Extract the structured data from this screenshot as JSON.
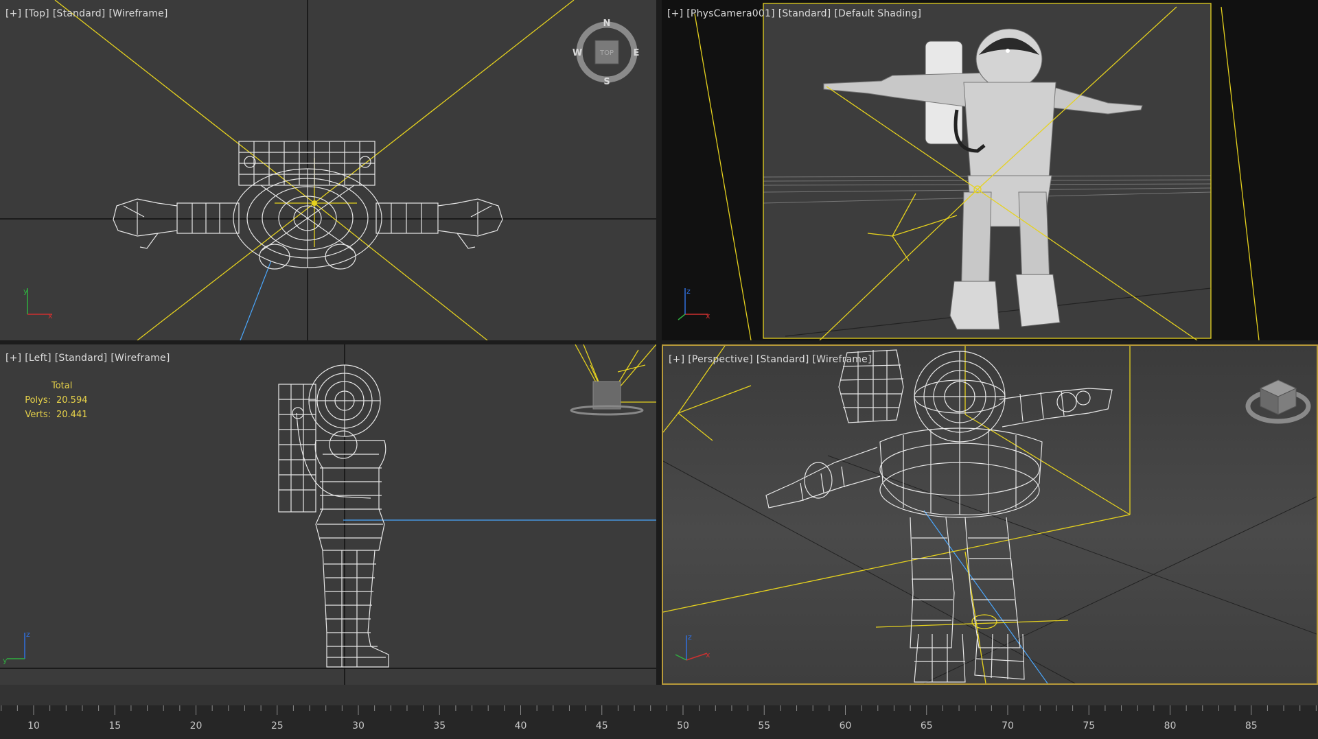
{
  "viewports": {
    "top": {
      "plus": "[+]",
      "view": "[Top]",
      "mode": "[Standard]",
      "shading": "[Wireframe]"
    },
    "camera": {
      "plus": "[+]",
      "view": "[PhysCamera001]",
      "mode": "[Standard]",
      "shading": "[Default Shading]"
    },
    "left": {
      "plus": "[+]",
      "view": "[Left]",
      "mode": "[Standard]",
      "shading": "[Wireframe]"
    },
    "perspective": {
      "plus": "[+]",
      "view": "[Perspective]",
      "mode": "[Standard]",
      "shading": "[Wireframe]"
    }
  },
  "viewcube": {
    "north": "N",
    "south": "S",
    "east": "E",
    "west": "W",
    "face": "TOP"
  },
  "stats": {
    "header": "Total",
    "polys_label": "Polys:",
    "polys_value": "20.594",
    "verts_label": "Verts:",
    "verts_value": "20.441"
  },
  "axis_labels": {
    "x": "x",
    "y": "y",
    "z": "z"
  },
  "timeline": {
    "labels": [
      "10",
      "15",
      "20",
      "25",
      "30",
      "35",
      "40",
      "45",
      "50",
      "55",
      "60",
      "65",
      "70",
      "75",
      "80",
      "85"
    ]
  },
  "colors": {
    "viewport_bg": "#3b3b3b",
    "camera_frustum": "#e6d21e",
    "active_border": "#b89a3a",
    "wireframe": "#e8e8e8",
    "axis_x": "#d03030",
    "axis_y": "#30b040",
    "axis_z": "#3070e0"
  }
}
